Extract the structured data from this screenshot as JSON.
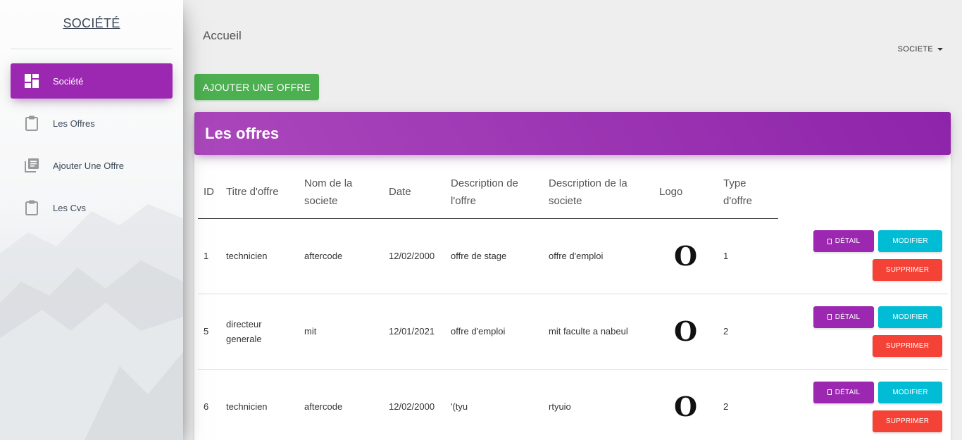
{
  "sidebar": {
    "brand": "SOCIÉTÉ",
    "items": [
      {
        "label": "Société",
        "icon": "dashboard-icon",
        "active": true
      },
      {
        "label": "Les Offres",
        "icon": "clipboard-icon",
        "active": false
      },
      {
        "label": "Ajouter Une Offre",
        "icon": "library-books-icon",
        "active": false
      },
      {
        "label": "Les Cvs",
        "icon": "clipboard-icon",
        "active": false
      }
    ]
  },
  "header": {
    "breadcrumb": "Accueil",
    "user_menu": "SOCIETE"
  },
  "actions": {
    "add_offer": "AJOUTER UNE OFFRE"
  },
  "card": {
    "title": "Les offres"
  },
  "table": {
    "columns": [
      "ID",
      "Titre d'offre",
      "Nom de la societe",
      "Date",
      "Description de l'offre",
      "Description de la societe",
      "Logo",
      "Type d'offre"
    ],
    "rows": [
      {
        "id": "1",
        "titre": "technicien",
        "nom": "aftercode",
        "date": "12/02/2000",
        "desc_offre": "offre de stage",
        "desc_societe": "offre d'emploi",
        "logo": "O",
        "type": "1"
      },
      {
        "id": "5",
        "titre": "directeur generale",
        "nom": "mit",
        "date": "12/01/2021",
        "desc_offre": "offre d'emploi",
        "desc_societe": "mit faculte a nabeul",
        "logo": "O",
        "type": "2"
      },
      {
        "id": "6",
        "titre": "technicien",
        "nom": "aftercode",
        "date": "12/02/2000",
        "desc_offre": "'(tyu",
        "desc_societe": "rtyuio",
        "logo": "O",
        "type": "2"
      }
    ],
    "buttons": {
      "detail": "DÉTAIL",
      "modifier": "MODIFIER",
      "supprimer": "SUPPRIMER"
    }
  },
  "colors": {
    "primary": "#9c27b0",
    "success": "#4caf50",
    "info": "#00bcd4",
    "danger": "#f44336"
  }
}
